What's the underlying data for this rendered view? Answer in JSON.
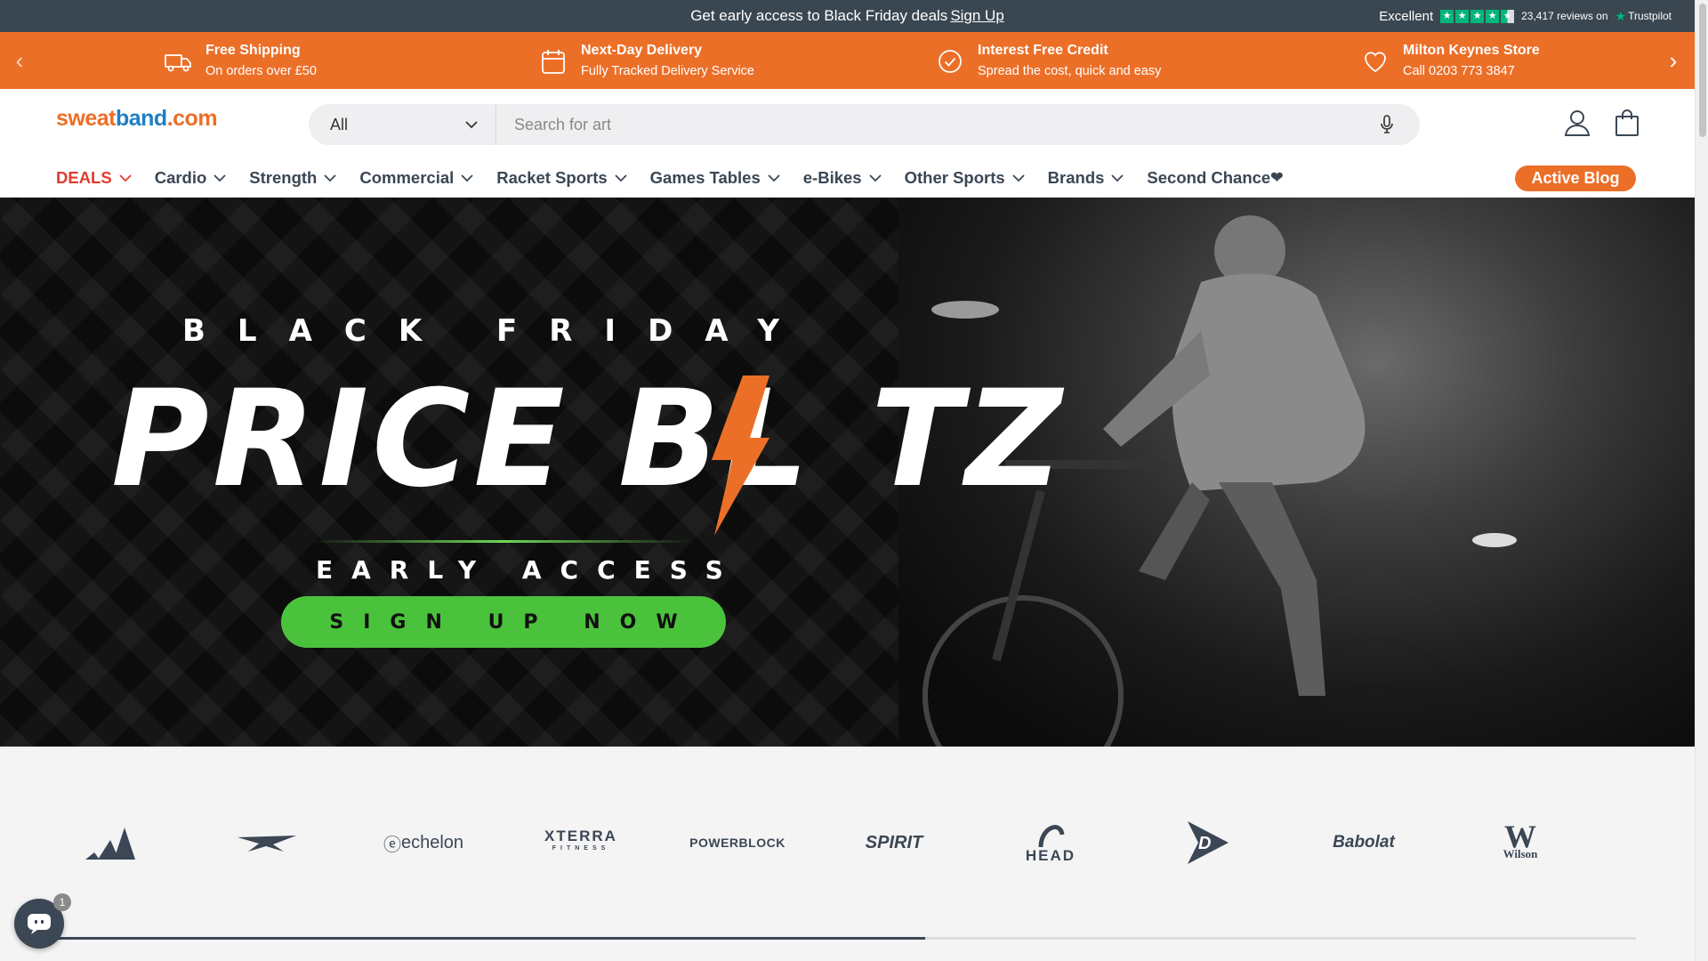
{
  "announcement": {
    "text": "Get early access to Black Friday deals",
    "link": "Sign Up"
  },
  "trustpilot": {
    "rating_word": "Excellent",
    "reviews": "23,417 reviews on",
    "brand": "Trustpilot",
    "stars": 4.5
  },
  "usp": [
    {
      "icon": "truck-icon",
      "title": "Free Shipping",
      "subtitle": "On orders over £50"
    },
    {
      "icon": "calendar-icon",
      "title": "Next-Day Delivery",
      "subtitle": "Fully Tracked Delivery Service"
    },
    {
      "icon": "check-circle-icon",
      "title": "Interest Free Credit",
      "subtitle": "Spread the cost, quick and easy"
    },
    {
      "icon": "heart-icon",
      "title": "Milton Keynes Store",
      "subtitle": "Call 0203 773 3847"
    }
  ],
  "logo": {
    "part1": "sweat",
    "part2": "band",
    "part3": ".com"
  },
  "search": {
    "category": "All",
    "placeholder": "Search for art"
  },
  "nav": {
    "items": [
      "DEALS",
      "Cardio",
      "Strength",
      "Commercial",
      "Racket Sports",
      "Games Tables",
      "e-Bikes",
      "Other Sports",
      "Brands",
      "Second Chance"
    ],
    "second_chance_heart": "❤",
    "blog": "Active Blog"
  },
  "hero": {
    "line1": "BLACK FRIDAY",
    "line2a": "PRICE BL",
    "line2b": "TZ",
    "line3": "EARLY ACCESS",
    "cta": "SIGN UP NOW"
  },
  "brands": [
    "adidas",
    "Reebok",
    "echelon",
    "XTERRA FITNESS",
    "POWERBLOCK",
    "SPIRIT",
    "HEAD",
    "Dunlop",
    "Babolat",
    "Wilson"
  ],
  "brand_labels": {
    "echelon": "echelon",
    "xterra": "XTERRA",
    "xterra_sub": "FITNESS",
    "powerblock": "POWERBLOCK",
    "spirit": "SPIRIT",
    "head": "HEAD",
    "babolat": "Babolat",
    "wilson": "Wilson"
  },
  "carousel_progress": 0.55,
  "chat_badge": "1",
  "colors": {
    "orange": "#ec6f28",
    "dark": "#3b4754",
    "green": "#4bc23b",
    "deals_red": "#e03c2d",
    "trustpilot": "#00b67a"
  }
}
